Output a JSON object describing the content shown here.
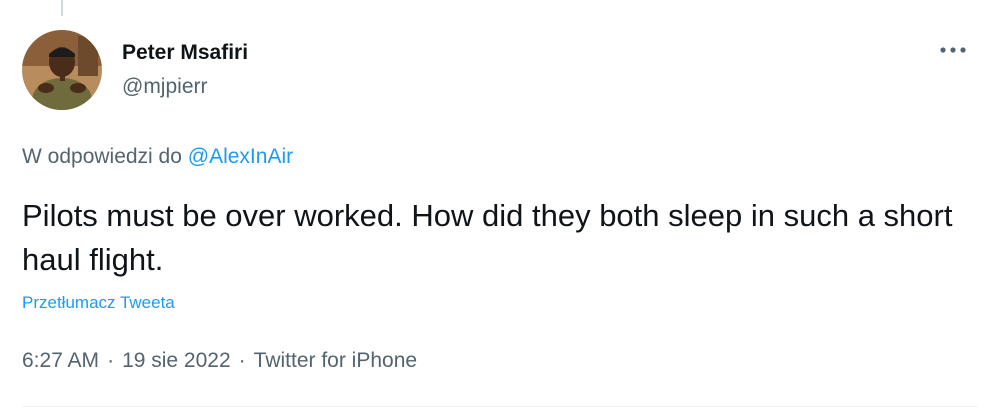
{
  "tweet": {
    "author": {
      "display_name": "Peter Msafiri",
      "handle": "@mjpierr"
    },
    "reply": {
      "prefix": "W odpowiedzi do",
      "mention": "@AlexInAir"
    },
    "text": "Pilots must be over worked. How did they both sleep in such a short haul flight.",
    "translate_label": "Przetłumacz Tweeta",
    "time": "6:27 AM",
    "date": "19 sie 2022",
    "source": "Twitter for iPhone",
    "separator": "·"
  },
  "icons": {
    "more": "more-horizontal-icon"
  },
  "colors": {
    "link": "#1d9bf0",
    "secondary_text": "#536471",
    "primary_text": "#0f1419"
  }
}
